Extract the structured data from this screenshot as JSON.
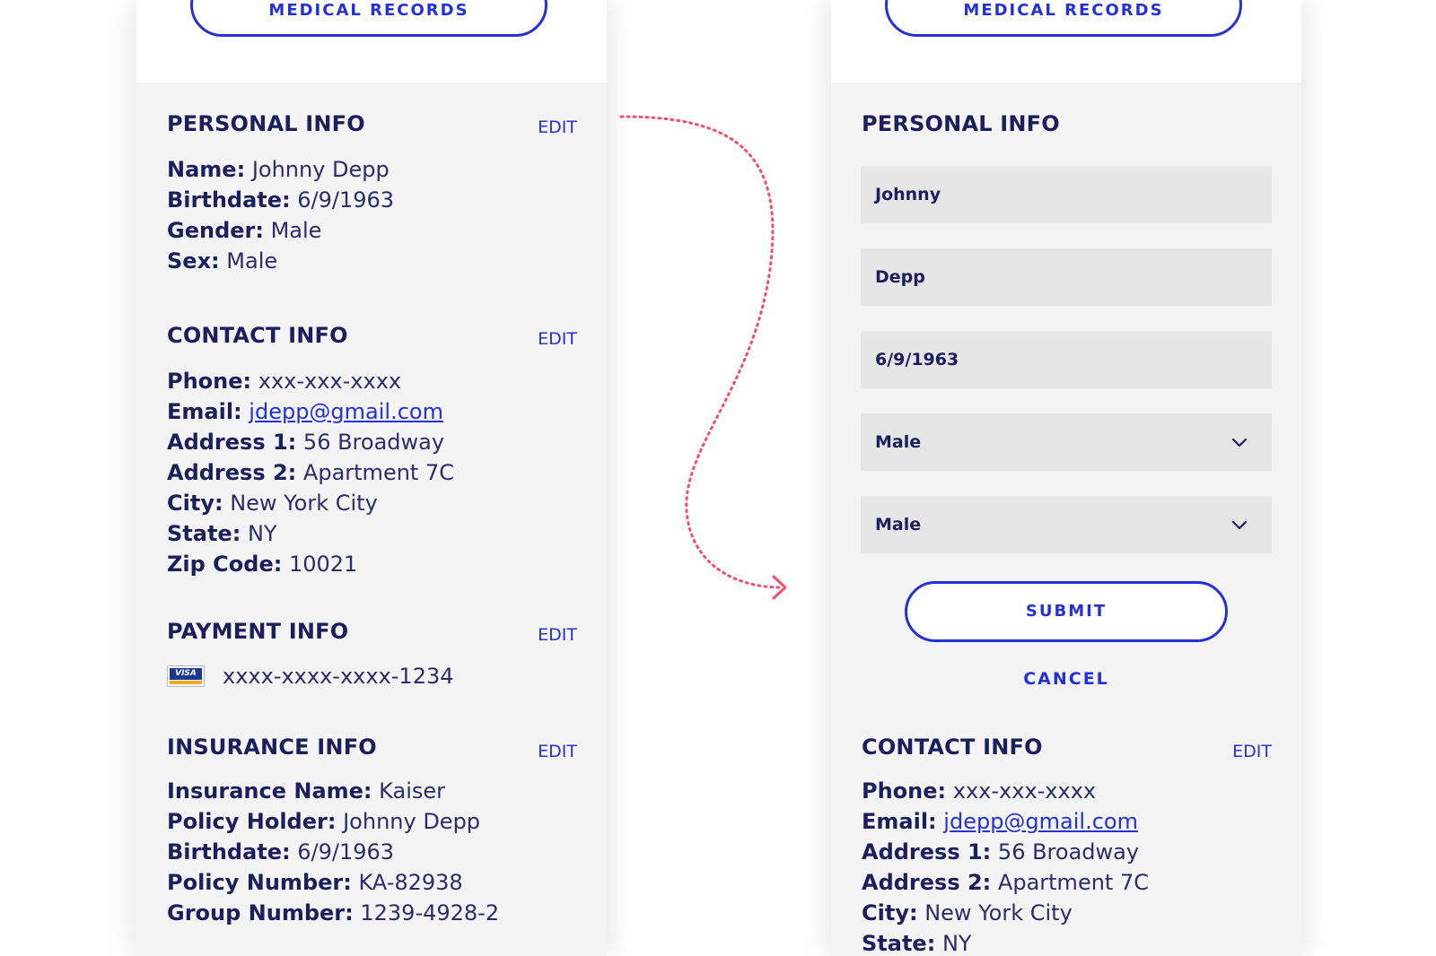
{
  "colors": {
    "accent": "#2530d6",
    "text": "#1c1f5c",
    "panel_bg": "#f4f4f4",
    "field_bg": "#e6e6e6",
    "connector": "#f0506e"
  },
  "left_panel": {
    "top_button_label": "MEDICAL RECORDS",
    "personal": {
      "title": "PERSONAL INFO",
      "edit": "EDIT",
      "rows": [
        {
          "label": "Name:",
          "value": "Johnny Depp"
        },
        {
          "label": "Birthdate:",
          "value": "6/9/1963"
        },
        {
          "label": "Gender:",
          "value": "Male"
        },
        {
          "label": "Sex:",
          "value": "Male"
        }
      ]
    },
    "contact": {
      "title": "CONTACT INFO",
      "edit": "EDIT",
      "rows": [
        {
          "label": "Phone:",
          "value": "xxx-xxx-xxxx"
        },
        {
          "label": "Email:",
          "value": "jdepp@gmail.com"
        },
        {
          "label": "Address 1:",
          "value": "56 Broadway"
        },
        {
          "label": "Address 2:",
          "value": "Apartment 7C"
        },
        {
          "label": "City:",
          "value": "New York City"
        },
        {
          "label": "State:",
          "value": "NY"
        },
        {
          "label": "Zip Code:",
          "value": "10021"
        }
      ]
    },
    "payment": {
      "title": "PAYMENT INFO",
      "edit": "EDIT",
      "card_brand": "VISA",
      "card_icon": "visa-card-icon",
      "card_number": "xxxx-xxxx-xxxx-1234"
    },
    "insurance": {
      "title": "INSURANCE INFO",
      "edit": "EDIT",
      "rows": [
        {
          "label": "Insurance Name:",
          "value": "Kaiser"
        },
        {
          "label": "Policy Holder:",
          "value": "Johnny Depp"
        },
        {
          "label": "Birthdate:",
          "value": "6/9/1963"
        },
        {
          "label": "Policy Number:",
          "value": "KA-82938"
        },
        {
          "label": "Group Number:",
          "value": "1239-4928-2"
        }
      ]
    }
  },
  "right_panel": {
    "top_button_label": "MEDICAL RECORDS",
    "personal_form": {
      "title": "PERSONAL INFO",
      "first_name": "Johnny",
      "last_name": "Depp",
      "birthdate": "6/9/1963",
      "gender": "Male",
      "sex": "Male",
      "submit": "SUBMIT",
      "cancel": "CANCEL"
    },
    "contact": {
      "title": "CONTACT INFO",
      "edit": "EDIT",
      "rows": [
        {
          "label": "Phone:",
          "value": "xxx-xxx-xxxx"
        },
        {
          "label": "Email:",
          "value": "jdepp@gmail.com"
        },
        {
          "label": "Address 1:",
          "value": "56 Broadway"
        },
        {
          "label": "Address 2:",
          "value": "Apartment 7C"
        },
        {
          "label": "City:",
          "value": "New York City"
        },
        {
          "label": "State:",
          "value": "NY"
        }
      ]
    }
  }
}
